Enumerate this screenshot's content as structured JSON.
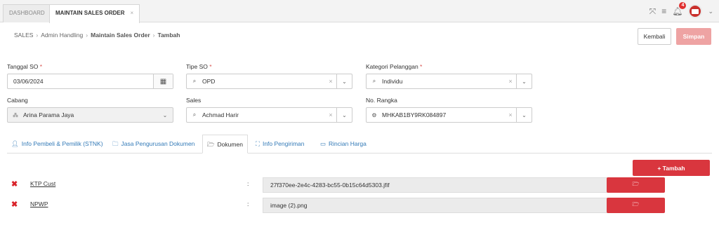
{
  "tabs": [
    {
      "label": "DASHBOARD"
    },
    {
      "label": "MAINTAIN SALES ORDER",
      "close": "×"
    }
  ],
  "topbar": {
    "notification_count": "4"
  },
  "breadcrumb": {
    "items": [
      "SALES",
      "Admin Handling",
      "Maintain Sales Order",
      "Tambah"
    ],
    "sep": "›"
  },
  "actions": {
    "back_label": "Kembali",
    "save_label": "Simpan"
  },
  "form": {
    "tanggal_so": {
      "label": "Tanggal SO",
      "required": "*",
      "value": "03/06/2024"
    },
    "tipe_so": {
      "label": "Tipe SO",
      "required": "*",
      "value": "OPD"
    },
    "kategori_pelanggan": {
      "label": "Kategori Pelanggan",
      "required": "*",
      "value": "Individu"
    },
    "cabang": {
      "label": "Cabang",
      "value": "Arina Parama Jaya"
    },
    "sales": {
      "label": "Sales",
      "value": "Achmad Harir"
    },
    "no_rangka": {
      "label": "No. Rangka",
      "value": "MHKAB1BY9RK084897"
    }
  },
  "detail_tabs": [
    {
      "label": "Info Pembeli & Pemilik (STNK)",
      "icon": "user-icon"
    },
    {
      "label": "Jasa Pengurusan Dokumen",
      "icon": "folder-icon"
    },
    {
      "label": "Dokumen",
      "icon": "folder-open-icon",
      "active": true
    },
    {
      "label": "Info Pengiriman",
      "icon": "map-icon"
    },
    {
      "label": "Rincian Harga",
      "icon": "money-icon"
    }
  ],
  "documents": {
    "add_label": "+ Tambah",
    "colon": ":",
    "rows": [
      {
        "name": "KTP Cust",
        "file": "27f370ee-2e4c-4283-bc55-0b15c64d5303.jfif"
      },
      {
        "name": "NPWP",
        "file": "image (2).png"
      }
    ]
  },
  "colors": {
    "danger": "#d9363e",
    "link": "#337ab7",
    "disabled_save": "#eea3a3"
  }
}
